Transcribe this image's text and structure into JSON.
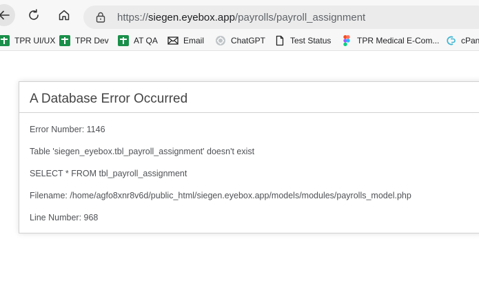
{
  "browser": {
    "url_prefix": "https://",
    "url_host": "siegen.eyebox.app",
    "url_path": "/payrolls/payroll_assignment",
    "icons": [
      "back-arrow-icon",
      "reload-icon",
      "home-icon",
      "lock-icon"
    ]
  },
  "bookmarks": [
    {
      "label": "TPR UI/UX",
      "icon": "green-plus-icon"
    },
    {
      "label": "TPR Dev",
      "icon": "green-plus-icon"
    },
    {
      "label": "AT QA",
      "icon": "green-plus-icon"
    },
    {
      "label": "Email",
      "icon": "envelope-icon"
    },
    {
      "label": "ChatGPT",
      "icon": "chatgpt-icon"
    },
    {
      "label": "Test Status",
      "icon": "document-icon"
    },
    {
      "label": "TPR Medical E-Com...",
      "icon": "figma-icon"
    },
    {
      "label": "cPan",
      "icon": "cpanel-icon"
    }
  ],
  "error": {
    "title": "A Database Error Occurred",
    "lines": [
      "Error Number: 1146",
      "Table 'siegen_eyebox.tbl_payroll_assignment' doesn't exist",
      "SELECT * FROM tbl_payroll_assignment",
      "Filename: /home/agfo8xnr8v6d/public_html/siegen.eyebox.app/models/modules/payrolls_model.php",
      "Line Number: 968"
    ]
  }
}
